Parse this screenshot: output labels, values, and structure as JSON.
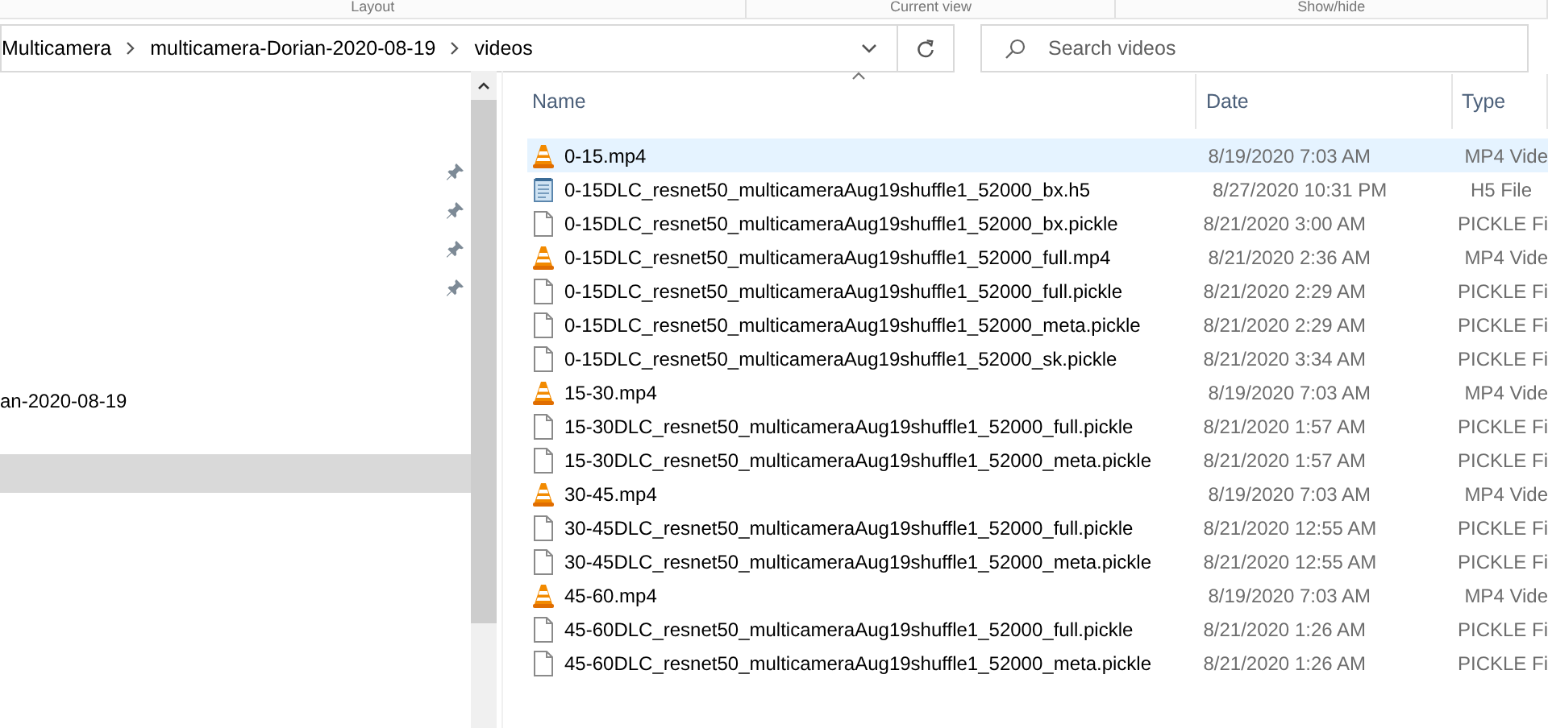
{
  "ribbon": {
    "groups": [
      "Layout",
      "Current view",
      "Show/hide"
    ]
  },
  "address_bar": {
    "breadcrumbs": [
      "Multicamera",
      "multicamera-Dorian-2020-08-19",
      "videos"
    ]
  },
  "search": {
    "placeholder": "Search videos"
  },
  "sidebar": {
    "items": [
      {
        "kind": "pinned",
        "selected": false
      },
      {
        "kind": "pinned",
        "selected": false
      },
      {
        "kind": "pinned",
        "selected": false
      },
      {
        "kind": "pinned",
        "selected": false
      },
      {
        "kind": "folder",
        "label": "an-2020-08-19",
        "selected": false
      },
      {
        "kind": "blank",
        "selected": true
      }
    ]
  },
  "file_list": {
    "columns": [
      "Name",
      "Date",
      "Type"
    ],
    "rows": [
      {
        "kind": "video",
        "name": "0-15.mp4",
        "date": "8/19/2020 7:03 AM",
        "type": "MP4 Vide",
        "selected": true
      },
      {
        "kind": "data",
        "name": "0-15DLC_resnet50_multicameraAug19shuffle1_52000_bx.h5",
        "date": "8/27/2020 10:31 PM",
        "type": "H5 File",
        "selected": false
      },
      {
        "kind": "document",
        "name": "0-15DLC_resnet50_multicameraAug19shuffle1_52000_bx.pickle",
        "date": "8/21/2020 3:00 AM",
        "type": "PICKLE Fi",
        "selected": false
      },
      {
        "kind": "video",
        "name": "0-15DLC_resnet50_multicameraAug19shuffle1_52000_full.mp4",
        "date": "8/21/2020 2:36 AM",
        "type": "MP4 Vide",
        "selected": false
      },
      {
        "kind": "document",
        "name": "0-15DLC_resnet50_multicameraAug19shuffle1_52000_full.pickle",
        "date": "8/21/2020 2:29 AM",
        "type": "PICKLE Fi",
        "selected": false
      },
      {
        "kind": "document",
        "name": "0-15DLC_resnet50_multicameraAug19shuffle1_52000_meta.pickle",
        "date": "8/21/2020 2:29 AM",
        "type": "PICKLE Fi",
        "selected": false
      },
      {
        "kind": "document",
        "name": "0-15DLC_resnet50_multicameraAug19shuffle1_52000_sk.pickle",
        "date": "8/21/2020 3:34 AM",
        "type": "PICKLE Fi",
        "selected": false
      },
      {
        "kind": "video",
        "name": "15-30.mp4",
        "date": "8/19/2020 7:03 AM",
        "type": "MP4 Vide",
        "selected": false
      },
      {
        "kind": "document",
        "name": "15-30DLC_resnet50_multicameraAug19shuffle1_52000_full.pickle",
        "date": "8/21/2020 1:57 AM",
        "type": "PICKLE Fi",
        "selected": false
      },
      {
        "kind": "document",
        "name": "15-30DLC_resnet50_multicameraAug19shuffle1_52000_meta.pickle",
        "date": "8/21/2020 1:57 AM",
        "type": "PICKLE Fi",
        "selected": false
      },
      {
        "kind": "video",
        "name": "30-45.mp4",
        "date": "8/19/2020 7:03 AM",
        "type": "MP4 Vide",
        "selected": false
      },
      {
        "kind": "document",
        "name": "30-45DLC_resnet50_multicameraAug19shuffle1_52000_full.pickle",
        "date": "8/21/2020 12:55 AM",
        "type": "PICKLE Fi",
        "selected": false
      },
      {
        "kind": "document",
        "name": "30-45DLC_resnet50_multicameraAug19shuffle1_52000_meta.pickle",
        "date": "8/21/2020 12:55 AM",
        "type": "PICKLE Fi",
        "selected": false
      },
      {
        "kind": "video",
        "name": "45-60.mp4",
        "date": "8/19/2020 7:03 AM",
        "type": "MP4 Vide",
        "selected": false
      },
      {
        "kind": "document",
        "name": "45-60DLC_resnet50_multicameraAug19shuffle1_52000_full.pickle",
        "date": "8/21/2020 1:26 AM",
        "type": "PICKLE Fi",
        "selected": false
      },
      {
        "kind": "document",
        "name": "45-60DLC_resnet50_multicameraAug19shuffle1_52000_meta.pickle",
        "date": "8/21/2020 1:26 AM",
        "type": "PICKLE Fi",
        "selected": false
      }
    ]
  }
}
